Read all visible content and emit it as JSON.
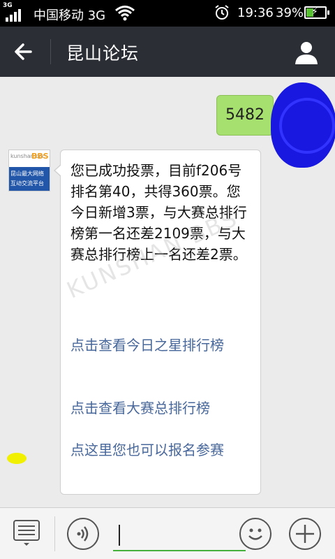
{
  "status_bar": {
    "network_type": "3G",
    "carrier": "中国移动 3G",
    "time": "19:36",
    "battery_percent": "39%",
    "battery_level": 0.39,
    "icons": [
      "signal-icon",
      "wifi-icon",
      "alarm-icon",
      "battery-icon"
    ]
  },
  "header": {
    "title": "昆山论坛",
    "back_icon": "back-arrow-icon",
    "profile_icon": "person-icon"
  },
  "messages": {
    "outgoing": {
      "text": "5482"
    },
    "incoming": {
      "sender_avatar": {
        "logo_text": "kunshan.ccc",
        "bbs_text": "BBS",
        "line1": "昆山最大网络",
        "line2": "互动交流平台"
      },
      "text": "您已成功投票，目前f206号排名第40，共得360票。您今日新增3票，与大赛总排行榜第一名还差2109票，与大赛总排行榜上一名还差2票。",
      "links": [
        "点击查看今日之星排行榜",
        "点击查看大赛总排行榜",
        "点这里您也可以报名参赛"
      ]
    }
  },
  "watermark": "KUNSHAN BBS",
  "input_bar": {
    "input_value": "",
    "menu_icon": "menu-list-icon",
    "voice_icon": "voice-icon",
    "emoji_icon": "emoji-icon",
    "plus_icon": "plus-icon"
  },
  "colors": {
    "header_bg": "#2b2e34",
    "outgoing_bubble": "#a6e06f",
    "link_color": "#48679a",
    "input_underline": "#45b03b"
  }
}
